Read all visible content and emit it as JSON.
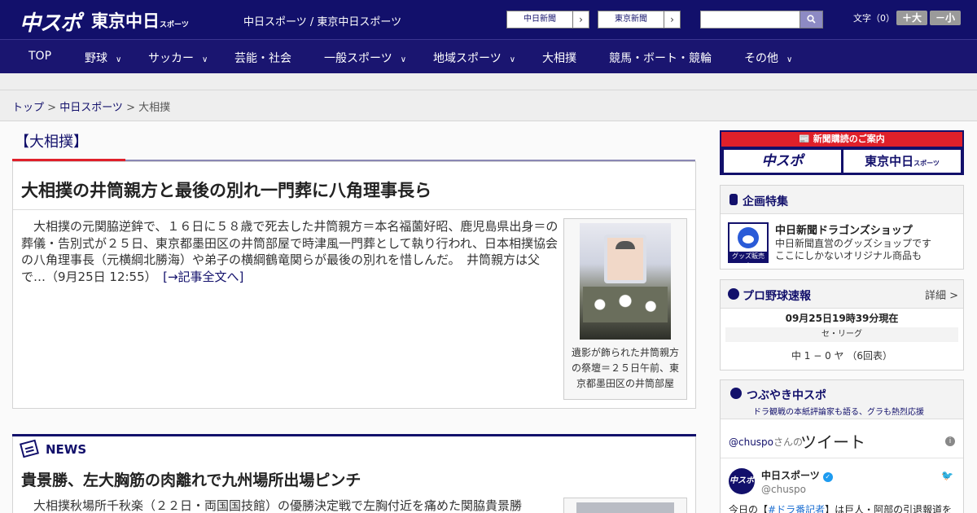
{
  "header": {
    "logo_chuspo": "中スポ",
    "logo_tokyo": "東京中日",
    "logo_tokyo_suffix": "スポーツ",
    "site_links": "中日スポーツ / 東京中日スポーツ",
    "btn_chunichi": "中日新聞",
    "btn_tokyo": "東京新聞",
    "search_icon": "search-icon",
    "font_size_label": "文字（0）",
    "font_bigger": "＋大",
    "font_smaller": "－小"
  },
  "nav": {
    "items": [
      {
        "label": "TOP",
        "has_menu": false
      },
      {
        "label": "野球",
        "has_menu": true
      },
      {
        "label": "サッカー",
        "has_menu": true
      },
      {
        "label": "芸能・社会",
        "has_menu": false
      },
      {
        "label": "一般スポーツ",
        "has_menu": true
      },
      {
        "label": "地域スポーツ",
        "has_menu": true
      },
      {
        "label": "大相撲",
        "has_menu": false
      },
      {
        "label": "競馬・ボート・競輪",
        "has_menu": false
      },
      {
        "label": "その他",
        "has_menu": true
      }
    ],
    "chevron": "∨"
  },
  "breadcrumb": {
    "top": "トップ",
    "sep1": " > ",
    "chuspo": "中日スポーツ",
    "sep2": " > ",
    "current": "大相撲"
  },
  "main": {
    "section_title": "【大相撲】",
    "article": {
      "headline": "大相撲の井筒親方と最後の別れ一門葬に八角理事長ら",
      "body": "　大相撲の元関脇逆鉾で、１６日に５８歳で死去した井筒親方＝本名福薗好昭、鹿児島県出身＝の葬儀・告別式が２５日、東京都墨田区の井筒部屋で時津風一門葬として執り行われ、日本相撲協会の八角理事長（元横綱北勝海）や弟子の横綱鶴竜関らが最後の別れを惜しんだ。　井筒親方は父で…（9月25日 12:55）　",
      "more_link": "[→記事全文へ]",
      "photo_caption": "遺影が飾られた井筒親方の祭壇＝２５日午前、東京都墨田区の井筒部屋"
    },
    "news": {
      "label": "NEWS",
      "headline": "貴景勝、左大胸筋の肉離れで九州場所出場ピンチ",
      "body": "　大相撲秋場所千秋楽（２２日・両国国技館）の優勝決定戦で左胸付近を痛めた関脇貴景勝"
    }
  },
  "sidebar": {
    "subscribe": {
      "head": "新聞購読のご案内",
      "logo_chuspo": "中スポ",
      "logo_tokyo": "東京中日",
      "logo_tokyo_suffix": "スポーツ"
    },
    "special": {
      "title": "企画特集",
      "shop_title": "中日新聞ドラゴンズショップ",
      "shop_desc_1": "中日新聞直営のグッズショップです",
      "shop_desc_2": "ここにしかないオリジナル商品も",
      "shop_tag": "グッズ販売中"
    },
    "baseball": {
      "title": "プロ野球速報",
      "more": "詳細 >",
      "time": "09月25日19時39分現在",
      "league": "セ・リーグ",
      "score": "中 1 − 0 ヤ （6回表）"
    },
    "tweets": {
      "title": "つぶやき中スポ",
      "subtitle": "ドラ観戦の本紙評論家も語る、グラも熱烈応援",
      "handle": "@chuspo",
      "handle_suffix": "さんの",
      "word": "ツイート",
      "info": "i",
      "avatar": "中スポ",
      "account_name": "中日スポーツ",
      "verified": "✓",
      "account_id": "@chuspo",
      "bird": "🐦",
      "text_before": "今日の【",
      "text_tag": "#ドラ番記者",
      "text_after": "】は巨人・阿部の引退報道を"
    }
  },
  "colors": {
    "brand_navy": "#12106b",
    "accent_red": "#e0202a"
  }
}
